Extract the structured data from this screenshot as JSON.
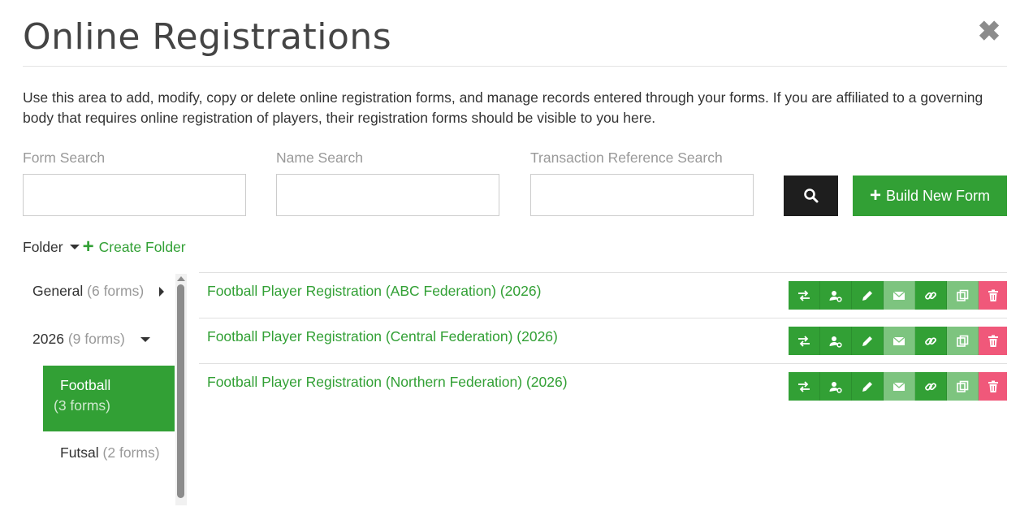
{
  "header": {
    "title": "Online Registrations",
    "close_icon": "close-icon"
  },
  "intro": "Use this area to add, modify, copy or delete online registration forms, and manage records entered through your forms. If you are affiliated to a governing body that requires online registration of players, their registration forms should be visible to you here.",
  "search": {
    "form_label": "Form Search",
    "form_value": "",
    "name_label": "Name Search",
    "name_value": "",
    "transaction_label": "Transaction Reference Search",
    "transaction_value": ""
  },
  "toolbar": {
    "search_icon": "search-icon",
    "build_label": "Build New Form"
  },
  "folders": {
    "label": "Folder",
    "create_label": "Create Folder",
    "items": [
      {
        "name": "General",
        "count": "(6 forms)"
      },
      {
        "name": "2026",
        "count": "(9 forms)"
      },
      {
        "name": "Football",
        "count": "(3 forms)"
      },
      {
        "name": "Futsal",
        "count": "(2 forms)"
      }
    ]
  },
  "forms": [
    {
      "title": "Football Player Registration (ABC Federation) (2026)"
    },
    {
      "title": "Football Player Registration (Central Federation) (2026)"
    },
    {
      "title": "Football Player Registration (Northern Federation) (2026)"
    }
  ],
  "action_icons": [
    "transfer-icon",
    "user-settings-icon",
    "edit-icon",
    "email-icon",
    "link-icon",
    "copy-icon",
    "trash-icon"
  ],
  "colors": {
    "accent": "#32a035",
    "accent_light": "#7dc47f",
    "danger": "#f0587a",
    "dark_button": "#1e1e1e",
    "muted_text": "#999999"
  }
}
